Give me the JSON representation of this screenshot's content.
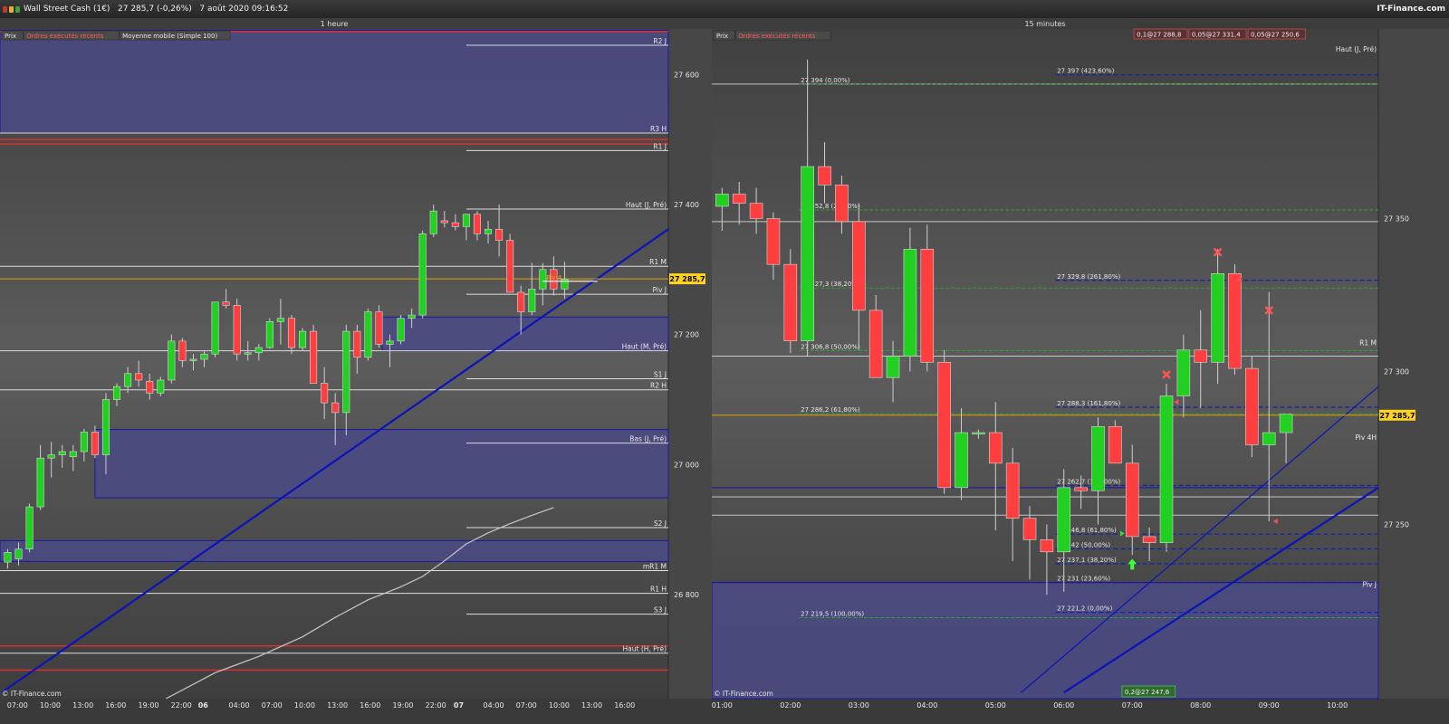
{
  "window": {
    "title": "Wall Street Cash (1€)   27 285,7 (-0,26%)   7 août 2020 09:16:52",
    "brand": "IT-Finance.com",
    "btn_colors": [
      "#c0392b",
      "#e0b030",
      "#3aa040"
    ]
  },
  "current_price": "27 285,7",
  "colors": {
    "bull": "#22d022",
    "bear": "#ff3f3f",
    "zone": "#4a4a82",
    "zone_border": "#1a1aa0",
    "trend": "#0a14b8",
    "price_line": "#e0a000",
    "price_badge": "#ffd21e",
    "resistance_red": "#d83030",
    "level_white": "#dcdcdc"
  },
  "chart_data": [
    {
      "type": "candlestick",
      "title": "1 heure",
      "legend": [
        "Prix",
        "Ordres exécutés récents",
        "Moyenne mobile (Simple 100)"
      ],
      "ylim": [
        26640,
        27670
      ],
      "y_ticks": [
        {
          "v": 27600,
          "label": "27 600"
        },
        {
          "v": 27400,
          "label": "27 400"
        },
        {
          "v": 27200,
          "label": "27 200"
        },
        {
          "v": 27000,
          "label": "27 000"
        },
        {
          "v": 26800,
          "label": "26 800"
        }
      ],
      "x_labels": [
        "07:00",
        "10:00",
        "13:00",
        "16:00",
        "19:00",
        "22:00",
        "06",
        "04:00",
        "07:00",
        "10:00",
        "13:00",
        "16:00",
        "19:00",
        "22:00",
        "07",
        "04:00",
        "07:00",
        "10:00",
        "13:00",
        "16:00"
      ],
      "x_label_pos": [
        0.9,
        3.9,
        6.9,
        9.9,
        12.9,
        15.9,
        17.9,
        21.2,
        24.2,
        27.2,
        30.2,
        33.2,
        36.2,
        39.2,
        41.3,
        44.5,
        47.5,
        50.5,
        53.5,
        56.5
      ],
      "x_bold": [
        6,
        14
      ],
      "xlim": [
        -0.7,
        60.5
      ],
      "levels": [
        {
          "v": 27645,
          "label": "R2 J",
          "color": "#dcdcdc",
          "from": 42
        },
        {
          "v": 27510,
          "label": "R3 H",
          "color": "#dcdcdc",
          "from": 0
        },
        {
          "v": 27483,
          "label": "R1 J",
          "color": "#dcdcdc",
          "from": 42
        },
        {
          "v": 27393,
          "label": "Haut (J, Pré)",
          "color": "#dcdcdc",
          "from": 42
        },
        {
          "v": 27305,
          "label": "R1 M",
          "color": "#dcdcdc",
          "from": 0
        },
        {
          "v": 27262,
          "label": "Piv J",
          "color": "#dcdcdc",
          "from": 42
        },
        {
          "v": 27175,
          "label": "Haut (M, Pré)",
          "color": "#dcdcdc",
          "from": 0
        },
        {
          "v": 27132,
          "label": "S1 J",
          "color": "#dcdcdc",
          "from": 42
        },
        {
          "v": 27115,
          "label": "R2 H",
          "color": "#dcdcdc",
          "from": 0
        },
        {
          "v": 27033,
          "label": "Bas (J, Pré)",
          "color": "#dcdcdc",
          "from": 42
        },
        {
          "v": 26903,
          "label": "S2 J",
          "color": "#dcdcdc",
          "from": 42
        },
        {
          "v": 26837,
          "label": "mR1 M",
          "color": "#dcdcdc",
          "from": 0
        },
        {
          "v": 26802,
          "label": "R1 H",
          "color": "#dcdcdc",
          "from": 0
        },
        {
          "v": 26770,
          "label": "S3 J",
          "color": "#dcdcdc",
          "from": 42
        },
        {
          "v": 26710,
          "label": "Haut (H, Pré)",
          "color": "#dcdcdc",
          "from": 0
        }
      ],
      "red_levels": [
        27666,
        27500,
        27493,
        26721,
        26684
      ],
      "zones": [
        {
          "from": -0.7,
          "to": 60.5,
          "v1": 27668,
          "v2": 27510
        },
        {
          "from": 34.3,
          "to": 60.5,
          "v1": 27227,
          "v2": 27175
        },
        {
          "from": 8,
          "to": 60.5,
          "v1": 27054,
          "v2": 26949
        },
        {
          "from": -0.7,
          "to": 60.5,
          "v1": 26883,
          "v2": 26851
        }
      ],
      "trendline": {
        "x1": -0.5,
        "y1": 26650,
        "x2": 60.5,
        "y2": 27362
      },
      "piv_arrow": {
        "x1": 49,
        "x2": 54,
        "v": 27282,
        "label": "Piv 4"
      },
      "ma": [
        [
          14.5,
          26640
        ],
        [
          19,
          26680
        ],
        [
          23,
          26705
        ],
        [
          27,
          26735
        ],
        [
          30,
          26765
        ],
        [
          33,
          26792
        ],
        [
          36,
          26812
        ],
        [
          38,
          26828
        ],
        [
          40,
          26852
        ],
        [
          42,
          26878
        ],
        [
          44,
          26895
        ],
        [
          46,
          26909
        ],
        [
          48,
          26922
        ],
        [
          50,
          26934
        ]
      ],
      "candles": [
        {
          "o": 26850,
          "h": 26870,
          "l": 26840,
          "c": 26865
        },
        {
          "o": 26855,
          "h": 26880,
          "l": 26845,
          "c": 26870
        },
        {
          "o": 26870,
          "h": 26940,
          "l": 26865,
          "c": 26935
        },
        {
          "o": 26935,
          "h": 27030,
          "l": 26930,
          "c": 27010
        },
        {
          "o": 27010,
          "h": 27035,
          "l": 26980,
          "c": 27015
        },
        {
          "o": 27015,
          "h": 27030,
          "l": 26995,
          "c": 27020
        },
        {
          "o": 27012,
          "h": 27030,
          "l": 26990,
          "c": 27020
        },
        {
          "o": 27020,
          "h": 27055,
          "l": 27005,
          "c": 27050
        },
        {
          "o": 27050,
          "h": 27060,
          "l": 27010,
          "c": 27015
        },
        {
          "o": 27015,
          "h": 27110,
          "l": 26985,
          "c": 27100
        },
        {
          "o": 27100,
          "h": 27125,
          "l": 27090,
          "c": 27120
        },
        {
          "o": 27120,
          "h": 27150,
          "l": 27110,
          "c": 27140
        },
        {
          "o": 27140,
          "h": 27160,
          "l": 27120,
          "c": 27130
        },
        {
          "o": 27128,
          "h": 27140,
          "l": 27100,
          "c": 27110
        },
        {
          "o": 27110,
          "h": 27135,
          "l": 27105,
          "c": 27130
        },
        {
          "o": 27130,
          "h": 27200,
          "l": 27125,
          "c": 27190
        },
        {
          "o": 27190,
          "h": 27195,
          "l": 27150,
          "c": 27160
        },
        {
          "o": 27160,
          "h": 27170,
          "l": 27145,
          "c": 27162
        },
        {
          "o": 27162,
          "h": 27175,
          "l": 27150,
          "c": 27170
        },
        {
          "o": 27170,
          "h": 27250,
          "l": 27165,
          "c": 27250
        },
        {
          "o": 27250,
          "h": 27270,
          "l": 27240,
          "c": 27245
        },
        {
          "o": 27245,
          "h": 27255,
          "l": 27160,
          "c": 27170
        },
        {
          "o": 27170,
          "h": 27190,
          "l": 27160,
          "c": 27172
        },
        {
          "o": 27172,
          "h": 27185,
          "l": 27160,
          "c": 27180
        },
        {
          "o": 27180,
          "h": 27225,
          "l": 27178,
          "c": 27220
        },
        {
          "o": 27220,
          "h": 27255,
          "l": 27185,
          "c": 27225
        },
        {
          "o": 27225,
          "h": 27230,
          "l": 27170,
          "c": 27180
        },
        {
          "o": 27180,
          "h": 27210,
          "l": 27175,
          "c": 27205
        },
        {
          "o": 27205,
          "h": 27215,
          "l": 27150,
          "c": 27125
        },
        {
          "o": 27125,
          "h": 27150,
          "l": 27070,
          "c": 27095
        },
        {
          "o": 27095,
          "h": 27110,
          "l": 27030,
          "c": 27080
        },
        {
          "o": 27080,
          "h": 27215,
          "l": 27045,
          "c": 27205
        },
        {
          "o": 27205,
          "h": 27215,
          "l": 27140,
          "c": 27165
        },
        {
          "o": 27165,
          "h": 27240,
          "l": 27160,
          "c": 27235
        },
        {
          "o": 27235,
          "h": 27245,
          "l": 27180,
          "c": 27185
        },
        {
          "o": 27185,
          "h": 27200,
          "l": 27150,
          "c": 27190
        },
        {
          "o": 27190,
          "h": 27230,
          "l": 27185,
          "c": 27225
        },
        {
          "o": 27225,
          "h": 27240,
          "l": 27210,
          "c": 27230
        },
        {
          "o": 27230,
          "h": 27360,
          "l": 27225,
          "c": 27355
        },
        {
          "o": 27355,
          "h": 27400,
          "l": 27350,
          "c": 27390
        },
        {
          "o": 27375,
          "h": 27390,
          "l": 27365,
          "c": 27372
        },
        {
          "o": 27372,
          "h": 27385,
          "l": 27360,
          "c": 27366
        },
        {
          "o": 27366,
          "h": 27385,
          "l": 27345,
          "c": 27385
        },
        {
          "o": 27385,
          "h": 27390,
          "l": 27345,
          "c": 27355
        },
        {
          "o": 27355,
          "h": 27375,
          "l": 27340,
          "c": 27362
        },
        {
          "o": 27362,
          "h": 27400,
          "l": 27320,
          "c": 27345
        },
        {
          "o": 27345,
          "h": 27355,
          "l": 27275,
          "c": 27265
        },
        {
          "o": 27265,
          "h": 27275,
          "l": 27200,
          "c": 27235
        },
        {
          "o": 27235,
          "h": 27310,
          "l": 27230,
          "c": 27270
        },
        {
          "o": 27270,
          "h": 27310,
          "l": 27245,
          "c": 27300
        },
        {
          "o": 27300,
          "h": 27320,
          "l": 27260,
          "c": 27270
        },
        {
          "o": 27270,
          "h": 27312,
          "l": 27255,
          "c": 27285
        }
      ]
    },
    {
      "type": "candlestick",
      "title": "15 minutes",
      "legend": [
        "Prix",
        "Ordres exécutés récents"
      ],
      "ylim": [
        27193,
        27412
      ],
      "y_ticks": [
        {
          "v": 27350,
          "label": "27 350"
        },
        {
          "v": 27300,
          "label": "27 300"
        },
        {
          "v": 27250,
          "label": "27 250"
        }
      ],
      "x_labels": [
        "01:00",
        "02:00",
        "03:00",
        "04:00",
        "05:00",
        "06:00",
        "07:00",
        "08:00",
        "09:00",
        "10:00"
      ],
      "x_label_pos": [
        0,
        4,
        8,
        12,
        16,
        20,
        24,
        28,
        32,
        36
      ],
      "xlim": [
        -0.6,
        38.4
      ],
      "order_badges": [
        "0,1@27 288,8",
        "0,05@27 331,4",
        "0,05@27 250,6"
      ],
      "bottom_badge": "0,2@27 247,6",
      "right_labels": [
        {
          "v": 27404,
          "label": "Haut (J, Pré)"
        },
        {
          "v": 27308,
          "label": "R1 M"
        },
        {
          "v": 27277,
          "label": "Piv 4H"
        },
        {
          "v": 27229,
          "label": "Piv J"
        }
      ],
      "fibs_a": [
        {
          "v": 27394,
          "label": "27 394 (0,00%)"
        },
        {
          "v": 27352.8,
          "label": "27 352,8 (23,60%)"
        },
        {
          "v": 27327.3,
          "label": "27 327,3 (38,20%)"
        },
        {
          "v": 27306.8,
          "label": "27 306,8 (50,00%)"
        },
        {
          "v": 27286.2,
          "label": "27 286,2 (61,80%)"
        },
        {
          "v": 27219.5,
          "label": "27 219,5 (100,00%)"
        }
      ],
      "fibs_b": [
        {
          "v": 27397,
          "label": "27 397 (423,60%)"
        },
        {
          "v": 27329.8,
          "label": "27 329,8 (261,80%)"
        },
        {
          "v": 27288.3,
          "label": "27 288,3 (161,80%)"
        },
        {
          "v": 27262.7,
          "label": "27 262,7 (100,00%)"
        },
        {
          "v": 27246.8,
          "label": "27 246,8 (61,80%)"
        },
        {
          "v": 27242,
          "label": "27 242 (50,00%)"
        },
        {
          "v": 27237.1,
          "label": "27 237,1 (38,20%)"
        },
        {
          "v": 27231,
          "label": "27 231 (23,60%)"
        },
        {
          "v": 27221.2,
          "label": "27 221,2 (0,00%)"
        }
      ],
      "white_levels": [
        27394,
        27349,
        27305,
        27259,
        27253
      ],
      "zones": [
        {
          "from": -0.6,
          "to": 38.4,
          "v1": 27231,
          "v2": 27193
        }
      ],
      "blue_hlines": [
        27262,
        27231
      ],
      "trendlines": [
        {
          "x1": 20,
          "y1": 27195,
          "x2": 38.4,
          "y2": 27262,
          "w": 2.2
        },
        {
          "x1": 17.5,
          "y1": 27195,
          "x2": 38.4,
          "y2": 27295,
          "w": 1.2
        }
      ],
      "crosses": [
        {
          "x": 26,
          "v": 27299
        },
        {
          "x": 29,
          "v": 27339
        },
        {
          "x": 32,
          "v": 27320
        }
      ],
      "ltri": [
        {
          "x": 30.3,
          "v": 27330
        },
        {
          "x": 26.6,
          "v": 27290
        },
        {
          "x": 32.4,
          "v": 27251
        }
      ],
      "rtri": [
        {
          "x": 23.4,
          "v": 27247
        }
      ],
      "up_arrow": {
        "x": 24,
        "v": 27237
      },
      "candles": [
        {
          "o": 27354,
          "h": 27360,
          "l": 27346,
          "c": 27358
        },
        {
          "o": 27358,
          "h": 27362,
          "l": 27348,
          "c": 27355
        },
        {
          "o": 27355,
          "h": 27360,
          "l": 27345,
          "c": 27350
        },
        {
          "o": 27350,
          "h": 27352,
          "l": 27330,
          "c": 27335
        },
        {
          "o": 27335,
          "h": 27340,
          "l": 27306,
          "c": 27310
        },
        {
          "o": 27310,
          "h": 27402,
          "l": 27305,
          "c": 27367
        },
        {
          "o": 27367,
          "h": 27375,
          "l": 27355,
          "c": 27361
        },
        {
          "o": 27361,
          "h": 27364,
          "l": 27345,
          "c": 27349
        },
        {
          "o": 27349,
          "h": 27355,
          "l": 27307,
          "c": 27320
        },
        {
          "o": 27320,
          "h": 27325,
          "l": 27298,
          "c": 27298
        },
        {
          "o": 27298,
          "h": 27310,
          "l": 27290,
          "c": 27305
        },
        {
          "o": 27305,
          "h": 27347,
          "l": 27300,
          "c": 27340
        },
        {
          "o": 27340,
          "h": 27348,
          "l": 27300,
          "c": 27303
        },
        {
          "o": 27303,
          "h": 27307,
          "l": 27260,
          "c": 27262
        },
        {
          "o": 27262,
          "h": 27288,
          "l": 27258,
          "c": 27280
        },
        {
          "o": 27280,
          "h": 27281,
          "l": 27278,
          "c": 27280
        },
        {
          "o": 27280,
          "h": 27290,
          "l": 27248,
          "c": 27270
        },
        {
          "o": 27270,
          "h": 27275,
          "l": 27238,
          "c": 27252
        },
        {
          "o": 27252,
          "h": 27256,
          "l": 27232,
          "c": 27245
        },
        {
          "o": 27245,
          "h": 27250,
          "l": 27227,
          "c": 27241
        },
        {
          "o": 27241,
          "h": 27268,
          "l": 27228,
          "c": 27262
        },
        {
          "o": 27262,
          "h": 27266,
          "l": 27255,
          "c": 27261
        },
        {
          "o": 27261,
          "h": 27285,
          "l": 27250,
          "c": 27282
        },
        {
          "o": 27282,
          "h": 27284,
          "l": 27271,
          "c": 27270
        },
        {
          "o": 27270,
          "h": 27276,
          "l": 27240,
          "c": 27246
        },
        {
          "o": 27246,
          "h": 27249,
          "l": 27238,
          "c": 27244
        },
        {
          "o": 27244,
          "h": 27296,
          "l": 27241,
          "c": 27292
        },
        {
          "o": 27292,
          "h": 27312,
          "l": 27285,
          "c": 27307
        },
        {
          "o": 27307,
          "h": 27320,
          "l": 27288,
          "c": 27303
        },
        {
          "o": 27303,
          "h": 27340,
          "l": 27296,
          "c": 27332
        },
        {
          "o": 27332,
          "h": 27335,
          "l": 27299,
          "c": 27301
        },
        {
          "o": 27301,
          "h": 27305,
          "l": 27272,
          "c": 27276
        },
        {
          "o": 27276,
          "h": 27326,
          "l": 27251,
          "c": 27280
        },
        {
          "o": 27280,
          "h": 27286,
          "l": 27270,
          "c": 27286
        }
      ]
    }
  ]
}
